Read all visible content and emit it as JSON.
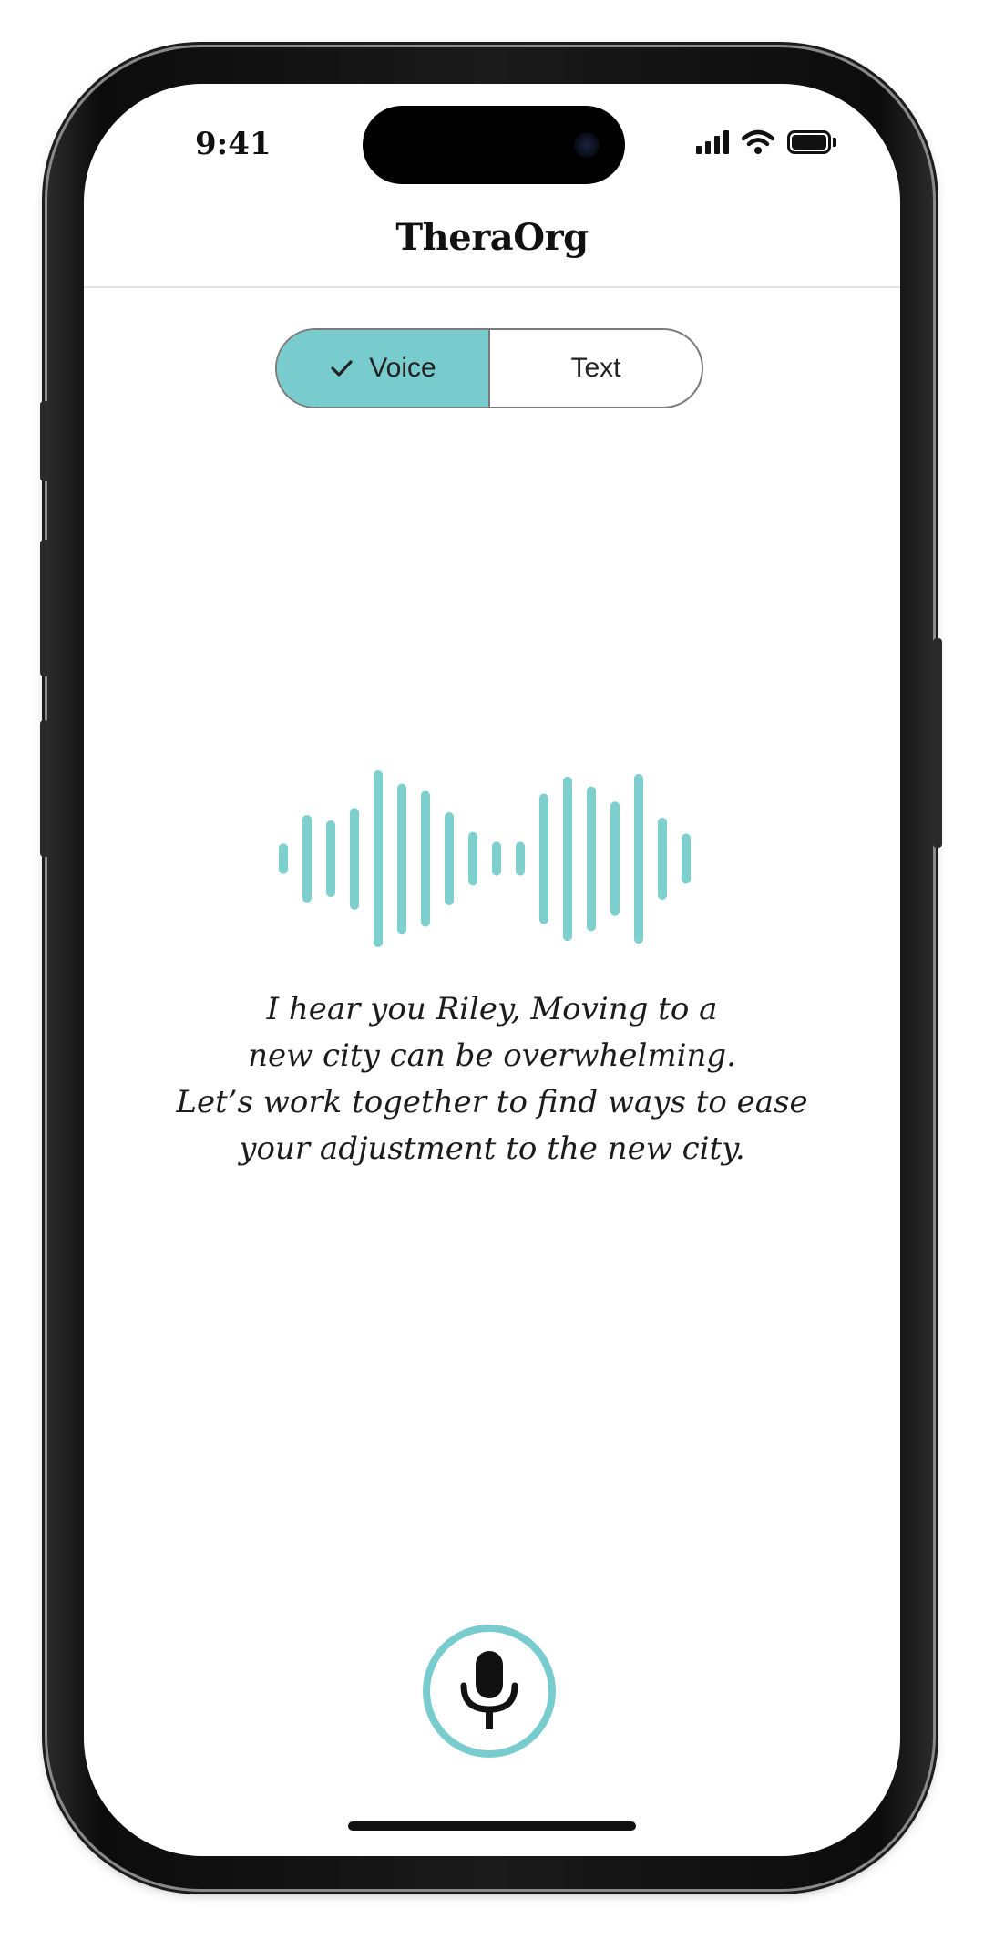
{
  "status_bar": {
    "time": "9:41",
    "icons": [
      "signal-icon",
      "wifi-icon",
      "battery-icon"
    ]
  },
  "header": {
    "title": "TheraOrg"
  },
  "mode_toggle": {
    "options": [
      {
        "label": "Voice",
        "selected": true,
        "icon": "check-icon"
      },
      {
        "label": "Text",
        "selected": false
      }
    ]
  },
  "waveform": {
    "color": "#7fcfcf",
    "bar_levels": [
      0.17,
      0.49,
      0.43,
      0.57,
      0.99,
      0.84,
      0.76,
      0.52,
      0.3,
      0.19,
      0.19,
      0.73,
      0.92,
      0.81,
      0.64,
      0.95,
      0.46,
      0.28
    ]
  },
  "message": {
    "lines": [
      "I hear you Riley, Moving to a",
      "new city can be overwhelming.",
      "Let’s work together to find ways to ease",
      "your adjustment to the new city."
    ]
  },
  "mic": {
    "icon": "microphone-icon",
    "ring_color": "#79cccd"
  },
  "theme": {
    "accent": "#79cccd",
    "text": "#111111",
    "background": "#ffffff"
  }
}
